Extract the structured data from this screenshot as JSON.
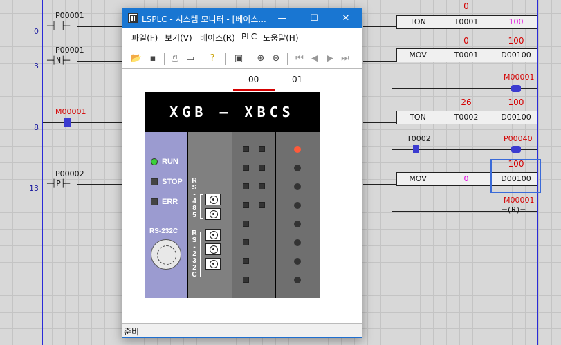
{
  "window": {
    "title": "LSPLC - 시스템 모니터 - [베이스...",
    "minimize": "—",
    "maximize": "☐",
    "close": "✕"
  },
  "menu": [
    "파일(F)",
    "보기(V)",
    "베이스(R)",
    "PLC",
    "도움말(H)"
  ],
  "toolbar_icons": [
    "open-icon",
    "save-icon",
    "print-icon",
    "print-preview-icon",
    "help-icon",
    "monitor-icon",
    "zoom-in-icon",
    "zoom-out-icon",
    "first-icon",
    "prev-icon",
    "next-icon",
    "last-icon"
  ],
  "tabs": [
    "00",
    "01"
  ],
  "active_tab": "00",
  "status": "준비",
  "plc": {
    "model": "XGB — XBCS",
    "leds": [
      {
        "label": "RUN",
        "color": "#3ad13a"
      },
      {
        "label": "STOP",
        "color": "#444444"
      },
      {
        "label": "ERR",
        "color": "#444444"
      }
    ],
    "port_label": "RS-232C",
    "rs485": "RS-485",
    "rs232c": "RS-232C"
  },
  "ladder": {
    "rungs": [
      {
        "number": "0",
        "contact_label": "P00001",
        "contact_symbol": "─┤ ├─"
      },
      {
        "number": "3",
        "contact_label": "P00001",
        "contact_symbol": "─┤N├─"
      },
      {
        "number": "8",
        "contact_label": "M00001",
        "contact_symbol": "─┤ ├─"
      },
      {
        "number": "13",
        "contact_label": "P00002",
        "contact_symbol": "─┤P├─"
      }
    ],
    "blocks": [
      {
        "op": "TON",
        "arg1": "T0001",
        "arg2": "100",
        "val1": "0",
        "val2": ""
      },
      {
        "op": "MOV",
        "arg1": "T0001",
        "arg2": "D00100",
        "val1": "0",
        "val2": "100"
      },
      {
        "op": "TON",
        "arg1": "T0002",
        "arg2": "D00100",
        "val1": "26",
        "val2": "100"
      },
      {
        "op": "MOV",
        "arg1": "0",
        "arg2": "D00100",
        "val1": "",
        "val2": "100"
      }
    ],
    "coils": [
      {
        "label": "M00001",
        "symbol": "─(S)─"
      },
      {
        "label": "P00040",
        "symbol": "─( )─"
      },
      {
        "label": "M00001",
        "symbol": "─(R)─"
      }
    ],
    "t0002_contact": "T0002"
  },
  "colors": {
    "accent": "#1976d2",
    "highlight": "#3b3bd0",
    "monitor_red": "#d40000",
    "monitor_magenta": "#e000e0"
  }
}
